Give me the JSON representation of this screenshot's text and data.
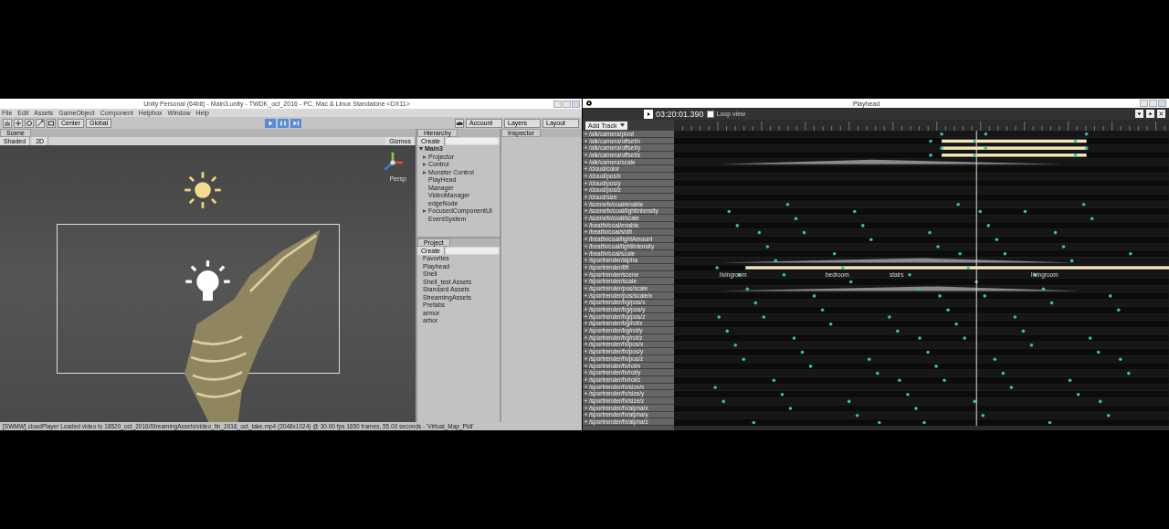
{
  "unity": {
    "title": "Unity Personal (64bit) - Main3.unity - TWDK_oct_2016 - PC, Mac & Linux Standalone <DX11>",
    "menu": [
      "File",
      "Edit",
      "Assets",
      "GameObject",
      "Component",
      "Helpbox",
      "Window",
      "Help"
    ],
    "pivot": "Center",
    "space": "Global",
    "account": "Account",
    "layers": "Layers",
    "layout": "Layout",
    "scene": {
      "tab": "Scene",
      "shading": "Shaded",
      "mode": "2D",
      "gizmos": "Gizmos",
      "view": "Persp"
    },
    "hierarchy": {
      "tab": "Hierarchy",
      "create": "Create",
      "items": [
        {
          "label": "Main3",
          "expanded": true,
          "children": [
            {
              "label": "Projector",
              "expanded": false
            },
            {
              "label": "Control",
              "expanded": false
            },
            {
              "label": "Monster Control",
              "expanded": false
            },
            {
              "label": "PlayHead"
            },
            {
              "label": "Manager"
            },
            {
              "label": "VideoManager"
            },
            {
              "label": "edgeNode"
            },
            {
              "label": "FocusedComponentUI",
              "expanded": false
            },
            {
              "label": "EventSystem"
            }
          ]
        }
      ]
    },
    "inspector": {
      "tab": "Inspector"
    },
    "project": {
      "tab": "Project",
      "create": "Create",
      "items": [
        "Favorites",
        "Playhead",
        "Shell",
        "Shell_test Assets",
        "Standard Assets",
        "StreamingAssets",
        "Prefabs",
        "armor",
        "arbor"
      ]
    },
    "status": "[SWMW] cloudPlayer Loaded video to 18520_oct_2016/StreamingAssets/video_fin_2016_oct_take.mp4 (2048x1024) @ 30.00 fps 1650 frames, 55.00 seconds - 'Virtual_Map_Pidi'"
  },
  "playhead": {
    "title": "Playhead",
    "time": "03:20:01.390",
    "loop": {
      "label": "Loop view",
      "checked": false
    },
    "add_track": "Add Track",
    "tracks": [
      "/alk/camera/pivot",
      "/alk/camera/offset/x",
      "/alk/camera/offset/y",
      "/alk/camera/offset/z",
      "/alk/camera/scale",
      "/cloud/color",
      "/cloud/pos/x",
      "/cloud/pos/y",
      "/cloud/pos/z",
      "/cloud/size",
      "/scenefx/coal/enable",
      "/scenefx/coal/lightIntensity",
      "/scenefx/coal/scale",
      "/beatfx/coal/enable",
      "/beatfx/coal/shift",
      "/beatfx/coal/lightAmount",
      "/beatfx/coal/lightIntensity",
      "/beatfx/coal/scale",
      "/sportrender/alpha",
      "/sportrender/lift",
      "/sportrender/scene",
      "/sportrender/scale",
      "/sportrender/pos/scale",
      "/sportrender/pos/scale/x",
      "/sportrender/bg/pos/x",
      "/sportrender/bg/pos/y",
      "/sportrender/bg/pos/z",
      "/sportrender/bg/rot/x",
      "/sportrender/bg/rot/y",
      "/sportrender/bg/rot/z",
      "/sportrender/fx/pos/x",
      "/sportrender/fx/pos/y",
      "/sportrender/fx/pos/z",
      "/sportrender/fx/rot/x",
      "/sportrender/fx/rot/y",
      "/sportrender/fx/rot/z",
      "/sportrender/fx/size/x",
      "/sportrender/fx/size/y",
      "/sportrender/fx/size/z",
      "/sportrender/fx/alpha/x",
      "/sportrender/fx/alpha/y",
      "/sportrender/fx/alpha/z"
    ],
    "scene_labels": [
      "livingroom",
      "bedroom",
      "stairs",
      "livingroom"
    ]
  }
}
